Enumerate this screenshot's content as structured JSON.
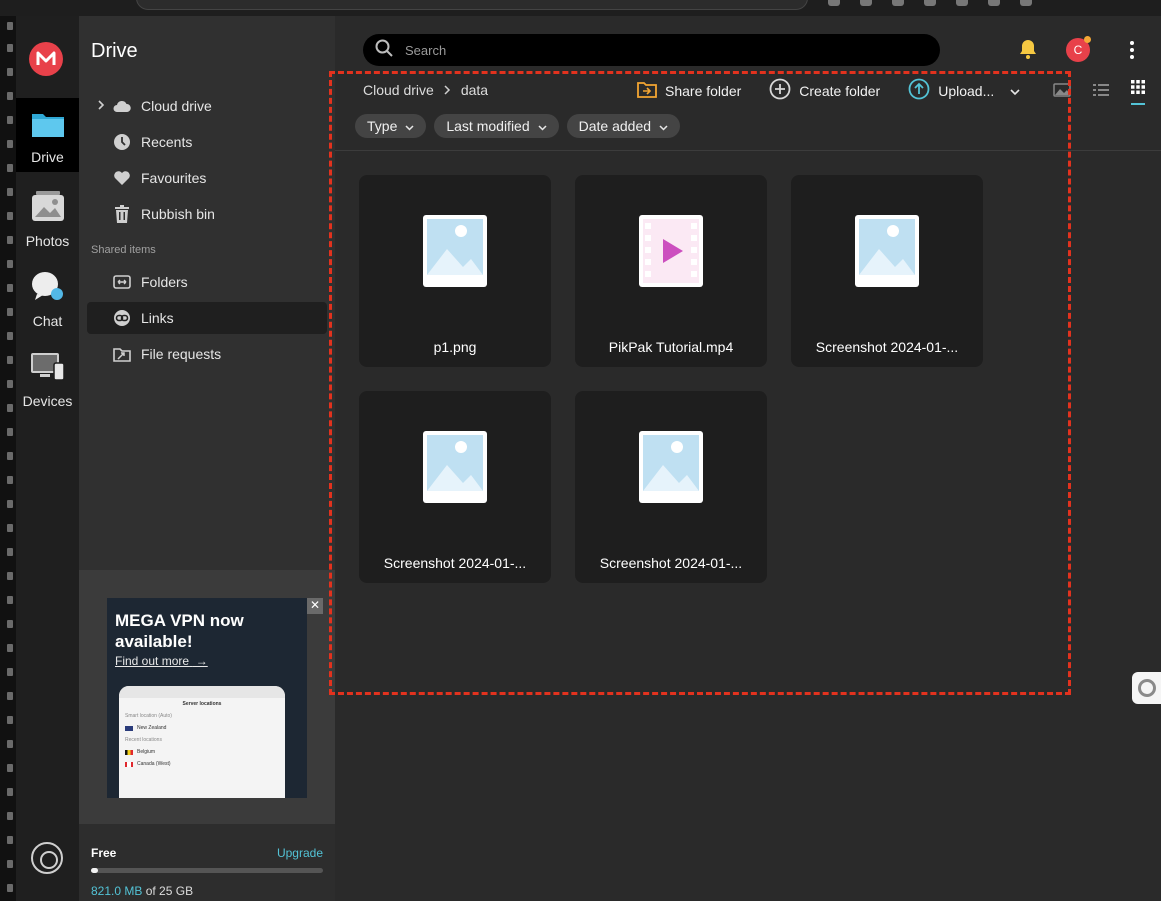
{
  "rail": {
    "items": [
      {
        "label": "Drive",
        "icon": "folder-icon"
      },
      {
        "label": "Photos",
        "icon": "photo-icon"
      },
      {
        "label": "Chat",
        "icon": "chat-icon"
      },
      {
        "label": "Devices",
        "icon": "devices-icon"
      }
    ]
  },
  "sidebar": {
    "title": "Drive",
    "items": [
      {
        "label": "Cloud drive",
        "icon": "cloud-icon"
      },
      {
        "label": "Recents",
        "icon": "clock-icon"
      },
      {
        "label": "Favourites",
        "icon": "heart-icon"
      },
      {
        "label": "Rubbish bin",
        "icon": "trash-icon"
      }
    ],
    "shared_heading": "Shared items",
    "shared_items": [
      {
        "label": "Folders",
        "icon": "shared-folder-icon"
      },
      {
        "label": "Links",
        "icon": "link-icon"
      },
      {
        "label": "File requests",
        "icon": "file-request-icon"
      }
    ],
    "promo": {
      "title": "MEGA VPN now available!",
      "link": "Find out more",
      "close": "✕",
      "phone_title": "Server locations",
      "phone_smart": "Smart location (Auto)",
      "phone_nz": "New Zealand",
      "phone_recent": "Recent locations",
      "phone_be": "Belgium",
      "phone_ca": "Canada (West)"
    },
    "storage": {
      "plan": "Free",
      "upgrade": "Upgrade",
      "used": "821.0 MB",
      "of_total": "of 25 GB",
      "used_fraction": 0.032
    }
  },
  "header": {
    "search_placeholder": "Search",
    "avatar_letter": "C"
  },
  "breadcrumb": [
    "Cloud drive",
    "data"
  ],
  "toolbar": {
    "share_folder": "Share folder",
    "create_folder": "Create folder",
    "upload": "Upload..."
  },
  "filters": [
    "Type",
    "Last modified",
    "Date added"
  ],
  "files": [
    {
      "name": "p1.png",
      "kind": "image"
    },
    {
      "name": "PikPak Tutorial.mp4",
      "kind": "video"
    },
    {
      "name": "Screenshot 2024-01-...",
      "kind": "image"
    },
    {
      "name": "Screenshot 2024-01-...",
      "kind": "image"
    },
    {
      "name": "Screenshot 2024-01-...",
      "kind": "image"
    }
  ],
  "colors": {
    "accent": "#53c3d6",
    "brand": "#e8414a",
    "highlight_box": "#e2321e"
  }
}
